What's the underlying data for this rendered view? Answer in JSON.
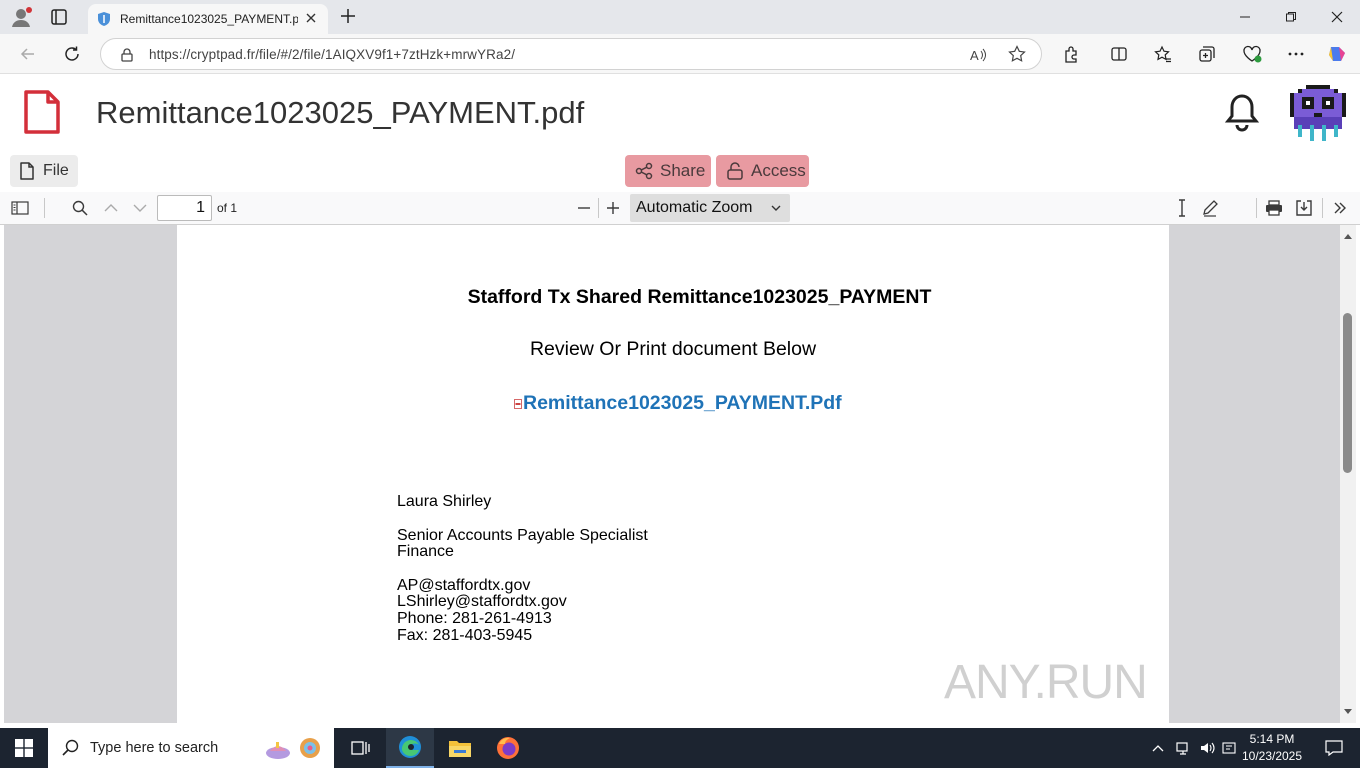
{
  "browser": {
    "tab_title": "Remittance1023025_PAYMENT.pd",
    "url": "https://cryptpad.fr/file/#/2/file/1AIQXV9f1+7ztHzk+mrwYRa2/"
  },
  "app": {
    "doc_title": "Remittance1023025_PAYMENT.pdf",
    "file_label": "File",
    "share_label": "Share",
    "access_label": "Access",
    "accent_color": "#e89aa1"
  },
  "pdf_toolbar": {
    "page_number": "1",
    "page_of": "of 1",
    "zoom": "Automatic Zoom"
  },
  "document": {
    "heading": "Stafford Tx Shared Remittance1023025_PAYMENT",
    "subheading": "Review Or Print document Below",
    "link_text": "Remittance1023025_PAYMENT.Pdf",
    "name": "Laura Shirley",
    "title": "Senior Accounts Payable Specialist",
    "department": "Finance",
    "email1": "AP@staffordtx.gov",
    "email2": "LShirley@staffordtx.gov",
    "phone": "Phone: 281-261-4913",
    "fax": "Fax: 281-403-5945"
  },
  "watermark": "ANY.RUN",
  "taskbar": {
    "search_placeholder": "Type here to search",
    "time": "5:14 PM",
    "date": "10/23/2025"
  }
}
